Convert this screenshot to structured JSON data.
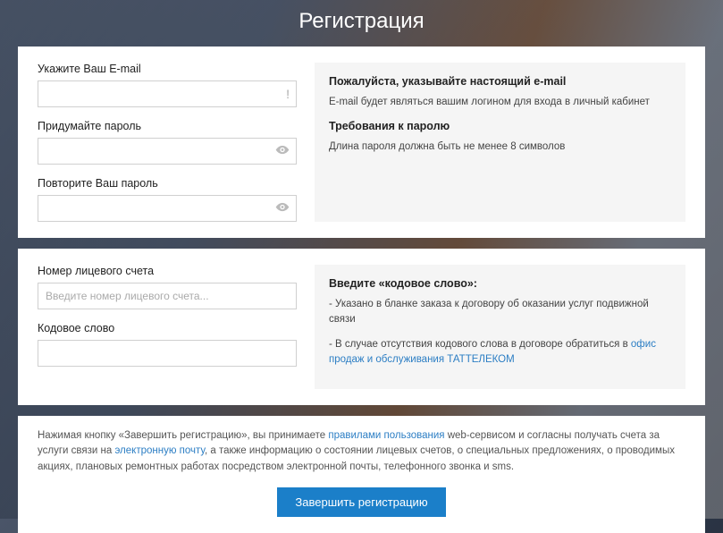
{
  "title": "Регистрация",
  "section1": {
    "email_label": "Укажите Ваш E-mail",
    "password_label": "Придумайте пароль",
    "password_repeat_label": "Повторите Ваш пароль",
    "info": {
      "heading1": "Пожалуйста, указывайте настоящий e-mail",
      "text1": "E-mail будет являться вашим логином для входа в личный кабинет",
      "heading2": "Требования к паролю",
      "text2": "Длина пароля должна быть не менее 8 символов"
    }
  },
  "section2": {
    "account_label": "Номер лицевого счета",
    "account_placeholder": "Введите номер лицевого счета...",
    "codeword_label": "Кодовое слово",
    "info": {
      "heading": "Введите «кодовое слово»:",
      "bullet1": "- Указано в бланке заказа к договору об оказании услуг подвижной связи",
      "bullet2_prefix": "- В случае отсутствия кодового слова в договоре обратиться в ",
      "bullet2_link": "офис продаж и обслуживания ТАТТЕЛЕКОМ"
    }
  },
  "terms": {
    "p1_prefix": "Нажимая кнопку «Завершить регистрацию», вы принимаете ",
    "p1_link1": "правилами пользования",
    "p1_mid": " web-сервисом и согласны получать счета за услуги связи на ",
    "p1_link2": "электронную почту",
    "p1_suffix": ", а также информацию о состоянии лицевых счетов, о специальных предложениях, о проводимых акциях, плановых ремонтных работах посредством электронной почты, телефонного звонка и sms."
  },
  "submit_label": "Завершить регистрацию"
}
